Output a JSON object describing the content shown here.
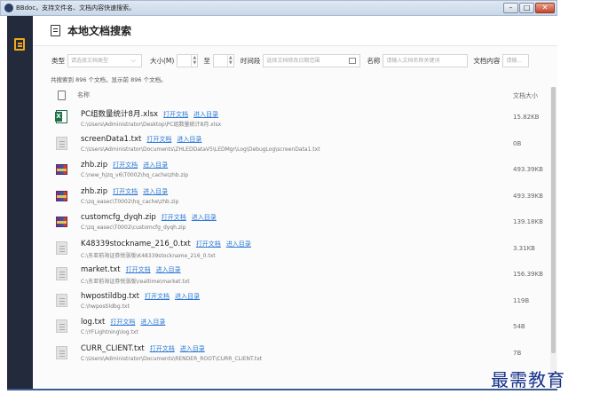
{
  "window": {
    "title": "BBdoc，支持文件名、文档内容快速搜索。",
    "buttons": {
      "minimize": "–",
      "maximize": "□",
      "close": "✕"
    }
  },
  "header": {
    "title": "本地文档搜索"
  },
  "filters": {
    "type_label": "类型",
    "type_placeholder": "请选择文档类型",
    "size_label": "大小(M)",
    "to_label": "至",
    "time_label": "时间段",
    "time_placeholder": "选择文档修改日期范围",
    "name_label": "名称",
    "name_placeholder": "请输入文档名称关键词",
    "content_label": "文档内容",
    "content_placeholder": "请输..."
  },
  "summary": "共搜索到 896 个文档，显示前 896 个文档。",
  "table": {
    "col_name": "名称",
    "col_size": "文档大小",
    "open_label": "打开文档",
    "dir_label": "进入目录",
    "rows": [
      {
        "icon": "excel-icon",
        "name": "PC组数量统计8月.xlsx",
        "path": "C:\\Users\\Administrator\\Desktop\\PC组数量统计8月.xlsx",
        "size": "15.82KB"
      },
      {
        "icon": "text-file-icon",
        "name": "screenData1.txt",
        "path": "C:\\Users\\Administrator\\Documents\\ZHLEDDataV5\\LEDMgr\\Log\\DebugLog\\screenData1.txt",
        "size": "0B"
      },
      {
        "icon": "zip-icon",
        "name": "zhb.zip",
        "path": "C:\\new_hjzq_v6\\T0002\\hq_cache\\zhb.zip",
        "size": "493.39KB"
      },
      {
        "icon": "zip-icon",
        "name": "zhb.zip",
        "path": "C:\\zq_easec\\T0002\\hq_cache\\zhb.zip",
        "size": "493.39KB"
      },
      {
        "icon": "zip-icon",
        "name": "customcfg_dyqh.zip",
        "path": "C:\\zq_easec\\T0002\\customcfg_dyqh.zip",
        "size": "139.18KB"
      },
      {
        "icon": "text-file-icon",
        "name": "K48339stockname_216_0.txt",
        "path": "C:\\东亚前海证券悦涨版\\K48339stockname_216_0.txt",
        "size": "3.31KB"
      },
      {
        "icon": "text-file-icon",
        "name": "market.txt",
        "path": "C:\\东亚前海证券悦涨版\\realtime\\market.txt",
        "size": "156.39KB"
      },
      {
        "icon": "text-file-icon",
        "name": "hwpostildbg.txt",
        "path": "C:\\hwpostildbg.txt",
        "size": "119B"
      },
      {
        "icon": "text-file-icon",
        "name": "log.txt",
        "path": "C:\\YFLightning\\log.txt",
        "size": "54B"
      },
      {
        "icon": "text-file-icon",
        "name": "CURR_CLIENT.txt",
        "path": "C:\\Users\\Administrator\\Documents\\RENDER_ROOT\\CURR_CLIENT.txt",
        "size": "7B"
      }
    ]
  },
  "watermark": "最需教育",
  "colors": {
    "sidebar": "#232a3b",
    "link": "#2b79d6",
    "accent": "#f0a71b"
  }
}
